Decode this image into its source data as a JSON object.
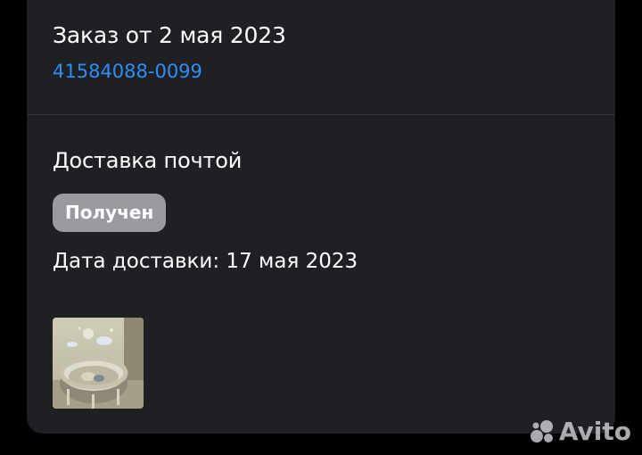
{
  "order": {
    "title": "Заказ от 2 мая 2023",
    "number": "41584088-0099"
  },
  "delivery": {
    "title": "Доставка почтой",
    "status": "Получен",
    "date_text": "Дата доставки: 17 мая 2023"
  },
  "item": {
    "thumbnail": "baby-crib-product-photo"
  },
  "watermark": {
    "text": "Avito"
  },
  "colors": {
    "background": "#000000",
    "card": "#1f2024",
    "link": "#2d8ef4",
    "badge": "#9a9ba1",
    "text": "#ffffff"
  }
}
